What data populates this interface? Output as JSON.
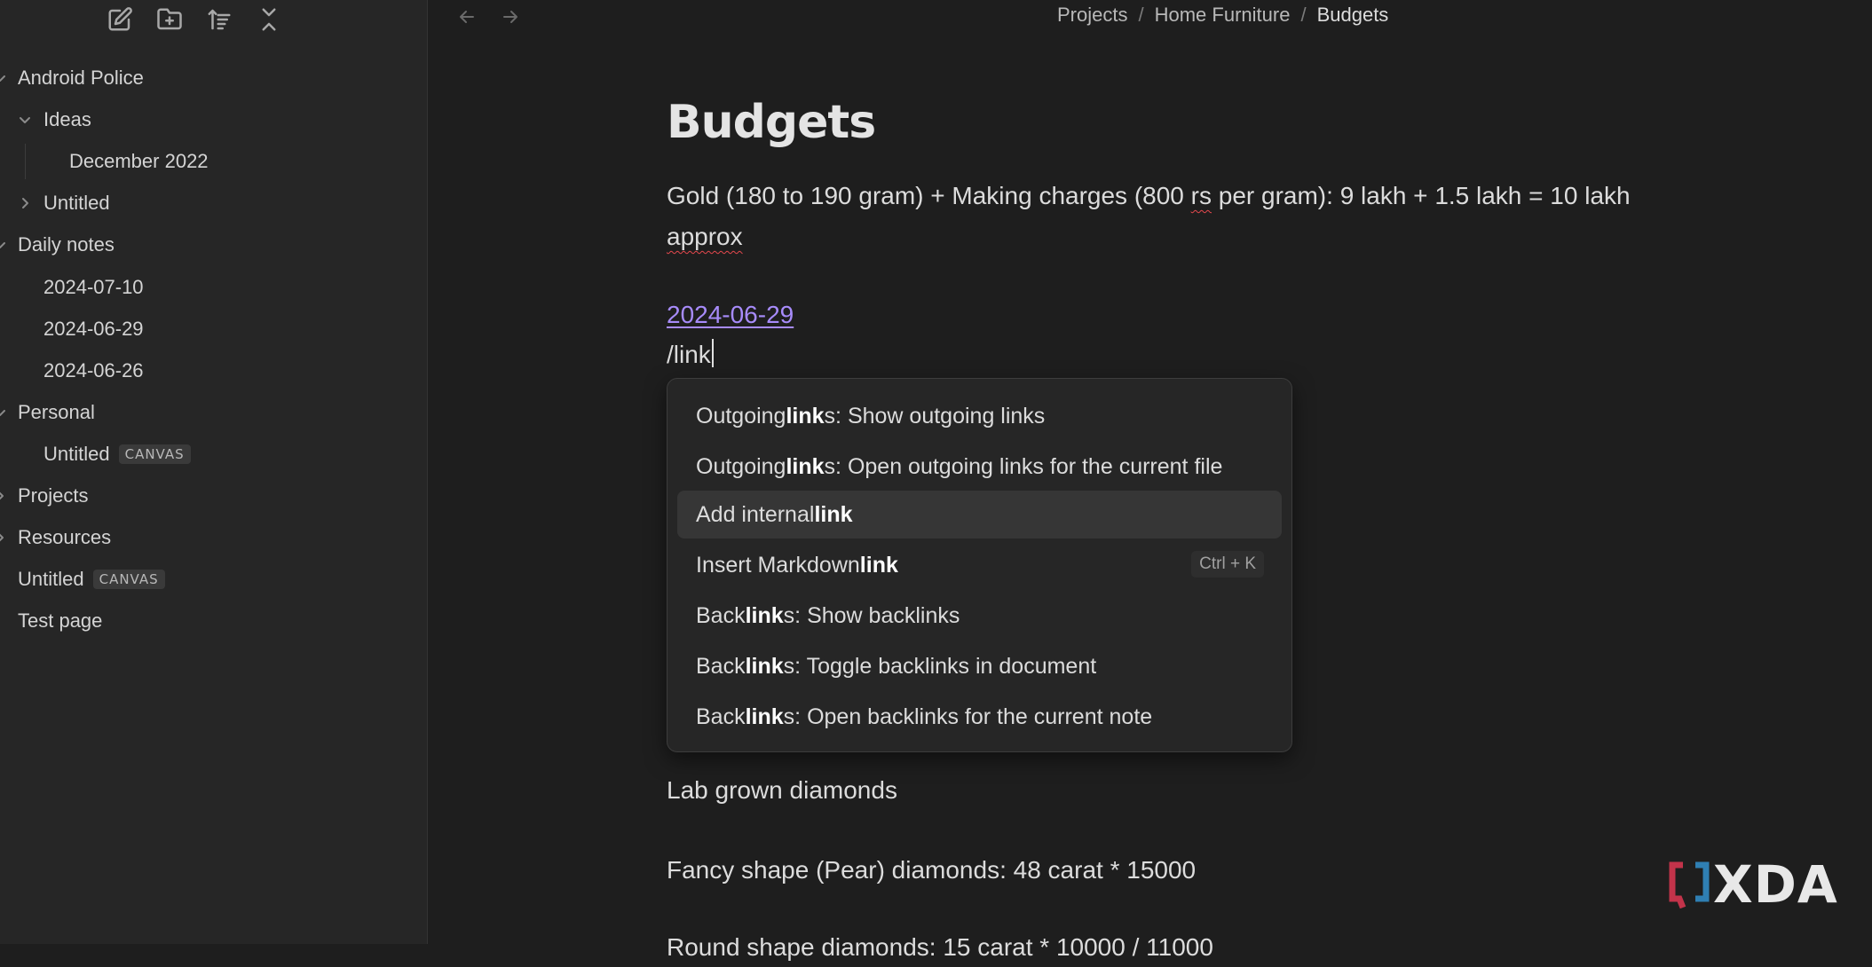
{
  "sidebar": {
    "toolbar": {
      "new_note": "new-note-icon",
      "new_folder": "new-folder-icon",
      "sort": "sort-icon",
      "collapse": "collapse-all-icon"
    },
    "items": [
      {
        "label": "Android Police",
        "expanded": true
      },
      {
        "label": "Ideas",
        "expanded": true
      },
      {
        "label": "December 2022"
      },
      {
        "label": "Untitled",
        "expanded": false
      },
      {
        "label": "Daily notes",
        "expanded": true
      },
      {
        "label": "2024-07-10"
      },
      {
        "label": "2024-06-29"
      },
      {
        "label": "2024-06-26"
      },
      {
        "label": "Personal",
        "expanded": true
      },
      {
        "label": "Untitled",
        "badge": "CANVAS"
      },
      {
        "label": "Projects"
      },
      {
        "label": "Resources"
      },
      {
        "label": "Untitled",
        "badge": "CANVAS"
      },
      {
        "label": "Test page"
      }
    ]
  },
  "breadcrumb": {
    "items": [
      "Projects",
      "Home Furniture",
      "Budgets"
    ],
    "separator": "/"
  },
  "document": {
    "title": "Budgets",
    "line1_a": "Gold (180 to 190 gram) + Making charges (800 ",
    "line1_rs": "rs",
    "line1_b": " per gram): 9 lakh + 1.5 lakh = 10 lakh",
    "line2": "approx",
    "date_link": "2024-06-29",
    "command_text": "/link",
    "after_1": "Lab grown diamonds",
    "after_2": "Fancy shape (Pear) diamonds: 48 carat * 15000",
    "after_3": "Round shape diamonds: 15 carat * 10000 / 11000"
  },
  "suggestions": [
    {
      "pre": "Outgoing ",
      "match": "link",
      "post": "s: Show outgoing links"
    },
    {
      "pre": "Outgoing ",
      "match": "link",
      "post": "s: Open outgoing links for the current file"
    },
    {
      "pre": "Add internal ",
      "match": "link",
      "post": "",
      "selected": true
    },
    {
      "pre": "Insert Markdown ",
      "match": "link",
      "post": "",
      "hotkey": "Ctrl + K"
    },
    {
      "pre": "Back",
      "match": "link",
      "post": "s: Show backlinks"
    },
    {
      "pre": "Back",
      "match": "link",
      "post": "s: Toggle backlinks in document"
    },
    {
      "pre": "Back",
      "match": "link",
      "post": "s: Open backlinks for the current note"
    }
  ],
  "watermark": {
    "text": "XDA"
  },
  "colors": {
    "background": "#1e1e1e",
    "sidebar": "#262626",
    "link": "#a78bfa",
    "spellcheck": "#e5484d",
    "watermark_red": "#c2334a",
    "watermark_blue": "#2f7fb3"
  }
}
